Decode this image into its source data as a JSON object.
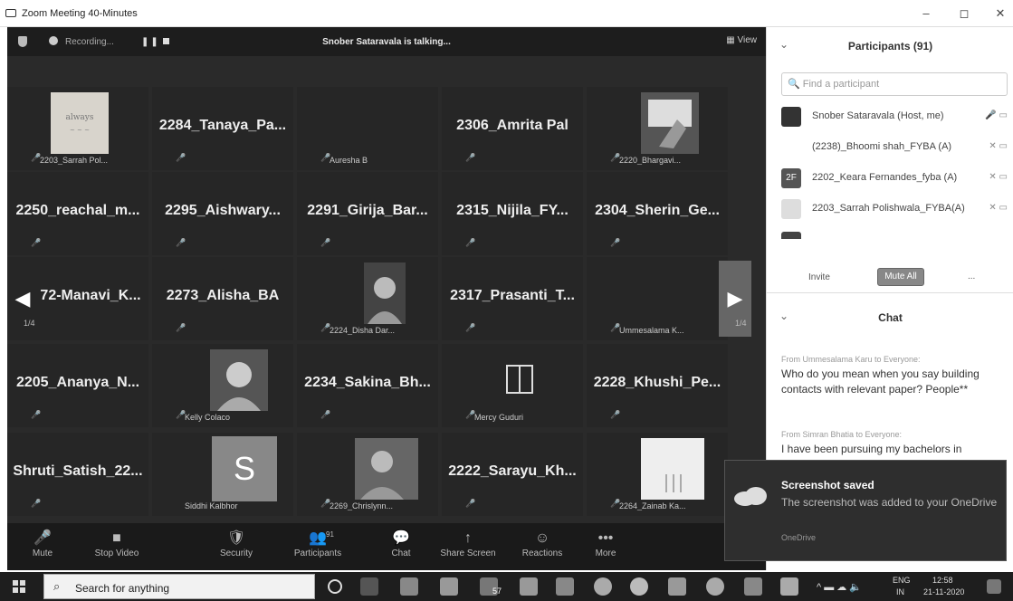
{
  "window": {
    "title": "Zoom Meeting 40-Minutes",
    "minimize": "–",
    "maximize": "◻",
    "close": "✕"
  },
  "topbar": {
    "recording_label": "Recording...",
    "talking": "Snober Sataravala is talking...",
    "view_label": "View"
  },
  "tiles": [
    {
      "big": "",
      "small": "2203_Sarrah Pol..."
    },
    {
      "big": "2284_Tanaya_Pa...",
      "small": ""
    },
    {
      "big": "",
      "small": "Auresha B"
    },
    {
      "big": "2306_Amrita Pal",
      "small": ""
    },
    {
      "big": "",
      "small": "2220_Bhargavi..."
    },
    {
      "big": "2250_reachal_m...",
      "small": ""
    },
    {
      "big": "2295_Aishwary...",
      "small": ""
    },
    {
      "big": "2291_Girija_Bar...",
      "small": ""
    },
    {
      "big": "2315_Nijila_FY...",
      "small": ""
    },
    {
      "big": "2304_Sherin_Ge...",
      "small": ""
    },
    {
      "big": "72-Manavi_K...",
      "small": ""
    },
    {
      "big": "2273_Alisha_BA",
      "small": ""
    },
    {
      "big": "",
      "small": "2224_Disha Dar..."
    },
    {
      "big": "2317_Prasanti_T...",
      "small": ""
    },
    {
      "big": "",
      "small": "Ummesalama K..."
    },
    {
      "big": "2205_Ananya_N...",
      "small": ""
    },
    {
      "big": "",
      "small": "Kelly Colaco"
    },
    {
      "big": "2234_Sakina_Bh...",
      "small": ""
    },
    {
      "big": "",
      "small": "Mercy Guduri"
    },
    {
      "big": "2228_Khushi_Pe...",
      "small": ""
    },
    {
      "big": "Shruti_Satish_22...",
      "small": ""
    },
    {
      "big": "",
      "small": "Siddhi Kalbhor",
      "initial": "S"
    },
    {
      "big": "",
      "small": "2269_Chrislynn..."
    },
    {
      "big": "2222_Sarayu_Kh...",
      "small": ""
    },
    {
      "big": "",
      "small": "2264_Zainab Ka..."
    }
  ],
  "paging": {
    "left": "1/4",
    "right": "1/4"
  },
  "toolbar": [
    {
      "icon": "🎤",
      "label": "Mute"
    },
    {
      "icon": "■",
      "label": "Stop Video"
    },
    {
      "icon": "🛡",
      "label": "Security"
    },
    {
      "icon": "👥",
      "label": "Participants",
      "count": "91"
    },
    {
      "icon": "💬",
      "label": "Chat"
    },
    {
      "icon": "↑",
      "label": "Share Screen"
    },
    {
      "icon": "☺",
      "label": "Reactions"
    },
    {
      "icon": "•••",
      "label": "More"
    }
  ],
  "participants": {
    "title": "Participants (91)",
    "search_placeholder": "Find a participant",
    "rows": [
      {
        "initials": "",
        "name": "Snober Sataravala (Host, me)"
      },
      {
        "initials": "",
        "name": "(2238)_Bhoomi shah_FYBA (A)"
      },
      {
        "initials": "2F",
        "name": "2202_Keara Fernandes_fyba (A)"
      },
      {
        "initials": "",
        "name": "2203_Sarrah Polishwala_FYBA(A)"
      }
    ],
    "invite": "Invite",
    "mute_all": "Mute All"
  },
  "chat": {
    "title": "Chat",
    "messages": [
      {
        "from": "From Ummesalama Karu to Everyone:",
        "text": "Who do you mean when you say building contacts with relevant paper? People**"
      },
      {
        "from": "From Simran Bhatia to Everyone:",
        "text": "I have been pursuing my bachelors in"
      }
    ]
  },
  "toast": {
    "title": "Screenshot saved",
    "message": "The screenshot was added to your OneDrive",
    "source": "OneDrive"
  },
  "taskbar": {
    "search_text": "Search for anything",
    "badge": "57",
    "lang_top": "ENG",
    "lang_bottom": "IN",
    "time": "12:58",
    "date": "21-11-2020"
  }
}
